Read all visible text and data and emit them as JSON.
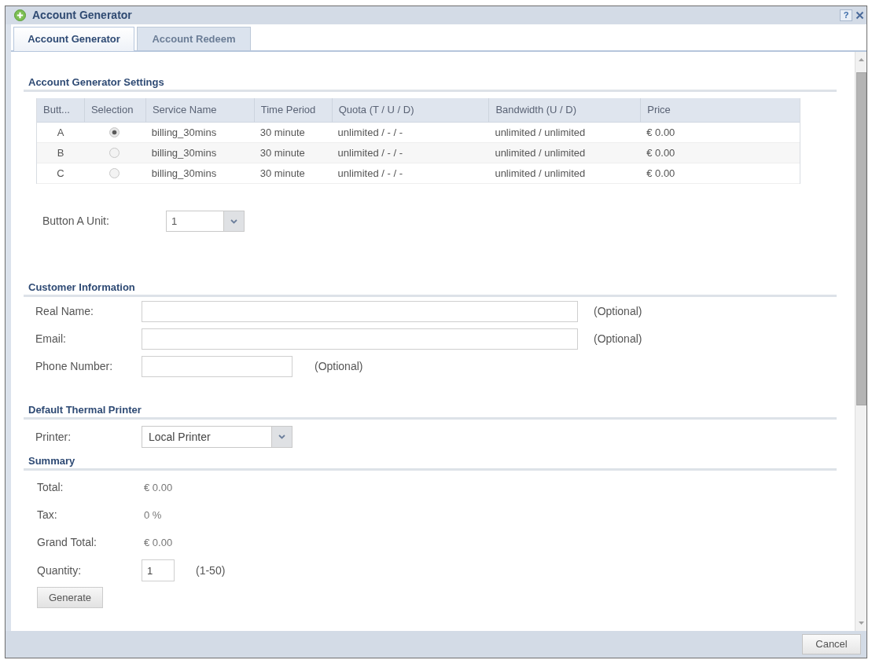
{
  "window": {
    "title": "Account Generator",
    "help": "?"
  },
  "tabs": [
    {
      "label": "Account Generator",
      "selected": true
    },
    {
      "label": "Account Redeem",
      "selected": false
    }
  ],
  "settings": {
    "heading": "Account Generator Settings",
    "table": {
      "columns": [
        "Butt...",
        "Selection",
        "Service Name",
        "Time Period",
        "Quota (T / U / D)",
        "Bandwidth (U / D)",
        "Price"
      ],
      "rows": [
        {
          "button": "A",
          "selected": true,
          "service_name": "billing_30mins",
          "time_period": "30 minute",
          "quota": "unlimited / - / -",
          "bandwidth": "unlimited / unlimited",
          "price": "€ 0.00"
        },
        {
          "button": "B",
          "selected": false,
          "service_name": "billing_30mins",
          "time_period": "30 minute",
          "quota": "unlimited / - / -",
          "bandwidth": "unlimited / unlimited",
          "price": "€ 0.00"
        },
        {
          "button": "C",
          "selected": false,
          "service_name": "billing_30mins",
          "time_period": "30 minute",
          "quota": "unlimited / - / -",
          "bandwidth": "unlimited / unlimited",
          "price": "€ 0.00"
        }
      ]
    },
    "unit": {
      "label": "Button A Unit:",
      "value": "1"
    }
  },
  "customer": {
    "heading": "Customer Information",
    "fields": [
      {
        "label": "Real Name:",
        "note": "(Optional)",
        "kind": "wide"
      },
      {
        "label": "Email:",
        "note": "(Optional)",
        "kind": "wide"
      },
      {
        "label": "Phone Number:",
        "note": "(Optional)",
        "kind": "narrow"
      }
    ]
  },
  "printer": {
    "heading": "Default Thermal Printer",
    "label": "Printer:",
    "value": "Local Printer"
  },
  "summary": {
    "heading": "Summary",
    "items": [
      {
        "label": "Total:",
        "value": "€ 0.00"
      },
      {
        "label": "Tax:",
        "value": "0 %"
      },
      {
        "label": "Grand Total:",
        "value": "€ 0.00"
      }
    ],
    "quantity": {
      "label": "Quantity:",
      "value": "1",
      "range": "(1-50)"
    },
    "button": "Generate"
  },
  "footer": {
    "button": "Cancel"
  }
}
